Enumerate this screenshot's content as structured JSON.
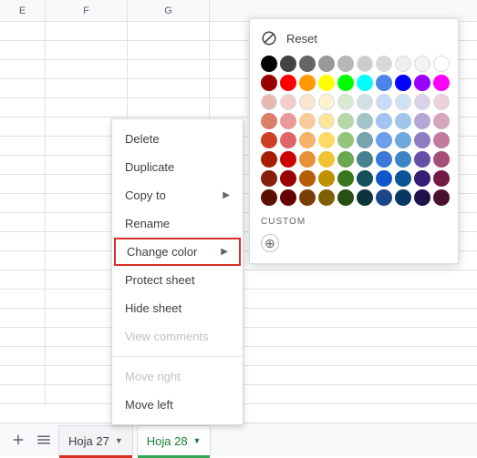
{
  "columns": [
    "E",
    "F",
    "G"
  ],
  "context_menu": {
    "delete": "Delete",
    "duplicate": "Duplicate",
    "copy_to": "Copy to",
    "rename": "Rename",
    "change_color": "Change color",
    "protect": "Protect sheet",
    "hide": "Hide sheet",
    "view_comments": "View comments",
    "move_right": "Move right",
    "move_left": "Move left"
  },
  "color_panel": {
    "reset": "Reset",
    "custom": "CUSTOM"
  },
  "colors": [
    [
      "#000000",
      "#434343",
      "#666666",
      "#999999",
      "#b7b7b7",
      "#cccccc",
      "#d9d9d9",
      "#efefef",
      "#f3f3f3",
      "#ffffff"
    ],
    [
      "#980000",
      "#ff0000",
      "#ff9900",
      "#ffff00",
      "#00ff00",
      "#00ffff",
      "#4a86e8",
      "#0000ff",
      "#9900ff",
      "#ff00ff"
    ],
    [
      "#e6b8af",
      "#f4cccc",
      "#fce5cd",
      "#fff2cc",
      "#d9ead3",
      "#d0e0e3",
      "#c9daf8",
      "#cfe2f3",
      "#d9d2e9",
      "#ead1dc"
    ],
    [
      "#dd7e6b",
      "#ea9999",
      "#f9cb9c",
      "#ffe599",
      "#b6d7a8",
      "#a2c4c9",
      "#a4c2f4",
      "#9fc5e8",
      "#b4a7d6",
      "#d5a6bd"
    ],
    [
      "#cc4125",
      "#e06666",
      "#f6b26b",
      "#ffd966",
      "#93c47d",
      "#76a5af",
      "#6d9eeb",
      "#6fa8dc",
      "#8e7cc3",
      "#c27ba0"
    ],
    [
      "#a61c00",
      "#cc0000",
      "#e69138",
      "#f1c232",
      "#6aa84f",
      "#45818e",
      "#3c78d8",
      "#3d85c6",
      "#674ea7",
      "#a64d79"
    ],
    [
      "#85200c",
      "#990000",
      "#b45f06",
      "#bf9000",
      "#38761d",
      "#134f5c",
      "#1155cc",
      "#0b5394",
      "#351c75",
      "#741b47"
    ],
    [
      "#5b0f00",
      "#660000",
      "#783f04",
      "#7f6000",
      "#274e13",
      "#0c343d",
      "#1c4587",
      "#073763",
      "#20124d",
      "#4c1130"
    ]
  ],
  "tabs": {
    "prev": {
      "label": "Hoja 27",
      "color": "#d93025"
    },
    "active": {
      "label": "Hoja 28",
      "color": "#34a853"
    }
  }
}
